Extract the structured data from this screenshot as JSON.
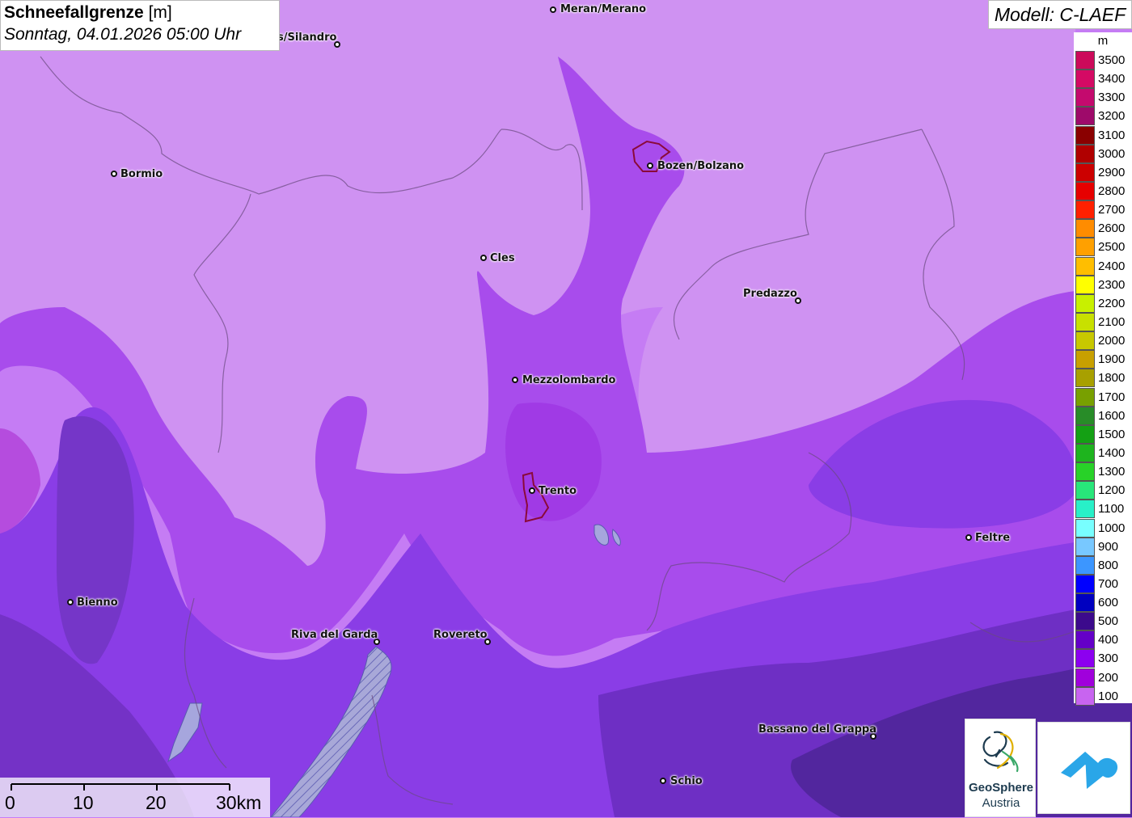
{
  "title": {
    "main": "Schneefallgrenze",
    "unit": "[m]",
    "date": "Sonntag, 04.01.2026 05:00 Uhr"
  },
  "model": "Modell: C-LAEF",
  "legend": {
    "unit": "m",
    "levels": [
      {
        "value": "3500",
        "color": "#cc0a5a"
      },
      {
        "value": "3400",
        "color": "#d40a64"
      },
      {
        "value": "3300",
        "color": "#c40a6e"
      },
      {
        "value": "3200",
        "color": "#9e0a6a"
      },
      {
        "value": "3100",
        "color": "#8a0000"
      },
      {
        "value": "3000",
        "color": "#b00000"
      },
      {
        "value": "2900",
        "color": "#cc0000"
      },
      {
        "value": "2800",
        "color": "#e60000"
      },
      {
        "value": "2700",
        "color": "#ff2000"
      },
      {
        "value": "2600",
        "color": "#ff8c00"
      },
      {
        "value": "2500",
        "color": "#ffa000"
      },
      {
        "value": "2400",
        "color": "#ffbe00"
      },
      {
        "value": "2300",
        "color": "#ffff00"
      },
      {
        "value": "2200",
        "color": "#c8f000"
      },
      {
        "value": "2100",
        "color": "#c8e000"
      },
      {
        "value": "2000",
        "color": "#c8c800"
      },
      {
        "value": "1900",
        "color": "#c8a000"
      },
      {
        "value": "1800",
        "color": "#a8a000"
      },
      {
        "value": "1700",
        "color": "#78a000"
      },
      {
        "value": "1600",
        "color": "#288c28"
      },
      {
        "value": "1500",
        "color": "#14a014"
      },
      {
        "value": "1400",
        "color": "#1eb41e"
      },
      {
        "value": "1300",
        "color": "#28d228"
      },
      {
        "value": "1200",
        "color": "#28e67a"
      },
      {
        "value": "1100",
        "color": "#28f0c8"
      },
      {
        "value": "1000",
        "color": "#78ffff"
      },
      {
        "value": "900",
        "color": "#78c8ff"
      },
      {
        "value": "800",
        "color": "#3c96ff"
      },
      {
        "value": "700",
        "color": "#0000ff"
      },
      {
        "value": "600",
        "color": "#0000c0"
      },
      {
        "value": "500",
        "color": "#3c0a8c"
      },
      {
        "value": "400",
        "color": "#6400c8"
      },
      {
        "value": "300",
        "color": "#8c00f0"
      },
      {
        "value": "200",
        "color": "#a000dc"
      },
      {
        "value": "100",
        "color": "#c864f0"
      }
    ]
  },
  "cities": [
    {
      "name": "Meran/Merano"
    },
    {
      "name": "s/Silandro"
    },
    {
      "name": "Bozen/Bolzano"
    },
    {
      "name": "Bormio"
    },
    {
      "name": "Cles"
    },
    {
      "name": "Predazzo"
    },
    {
      "name": "Mezzolombardo"
    },
    {
      "name": "Trento"
    },
    {
      "name": "Feltre"
    },
    {
      "name": "Bienno"
    },
    {
      "name": "Riva del Garda"
    },
    {
      "name": "Rovereto"
    },
    {
      "name": "Bassano del Grappa"
    },
    {
      "name": "Schio"
    }
  ],
  "scale": {
    "labels": [
      "0",
      "10",
      "20",
      "30km"
    ]
  },
  "logos": {
    "geosphere_line1": "GeoSphere",
    "geosphere_line2": "Austria"
  }
}
